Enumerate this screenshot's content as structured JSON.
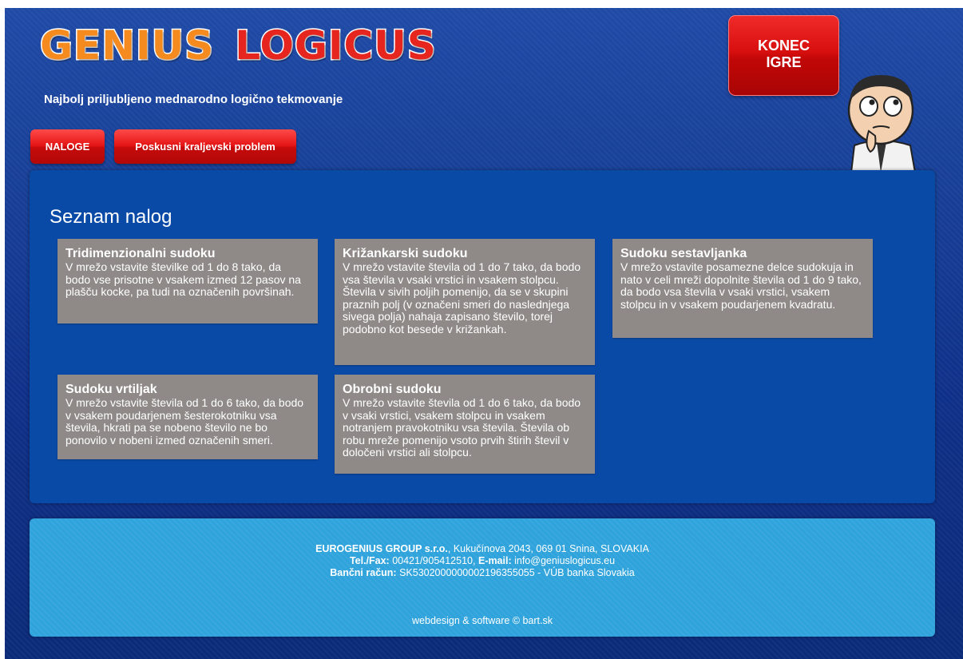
{
  "header": {
    "logo_word_1": "GENIUS",
    "logo_word_2": "LOGICUS",
    "tagline": "Najbolj priljubljeno mednarodno logično tekmovanje",
    "end_game_line1": "KONEC",
    "end_game_line2": "IGRE"
  },
  "nav": {
    "items": [
      {
        "label": "NALOGE"
      },
      {
        "label": "Poskusni kraljevski problem"
      }
    ]
  },
  "main": {
    "title": "Seznam nalog",
    "tasks": [
      {
        "title": "Tridimenzionalni sudoku",
        "description": "V mrežo vstavite številke od 1 do 8 tako, da bodo vse prisotne v vsakem izmed 12 pasov na plašču kocke, pa tudi na označenih površinah."
      },
      {
        "title": "Križankarski sudoku",
        "description": "V mrežo vstavite števila od 1 do 7 tako, da bodo vsa števila v vsaki vrstici in vsakem stolpcu. Števila v sivih poljih pomenijo, da se v skupini praznih polj (v označeni smeri do naslednjega sivega polja) nahaja zapisano število, torej podobno kot besede v križankah."
      },
      {
        "title": "Sudoku sestavljanka",
        "description": "V mrežo vstavite posamezne delce sudokuja in nato v celi mreži dopolnite števila od 1 do 9 tako, da bodo vsa števila v vsaki vrstici, vsakem stolpcu in v vsakem poudarjenem kvadratu."
      },
      {
        "title": "Sudoku vrtiljak",
        "description": "V mrežo vstavite števila od 1 do 6 tako, da bodo v vsakem poudarjenem šesterokotniku vsa števila, hkrati pa se nobeno število ne bo ponovilo v nobeni izmed označenih smeri."
      },
      {
        "title": "Obrobni sudoku",
        "description": "V mrežo vstavite števila od 1 do 6 tako, da bodo v vsaki vrstici, vsakem stolpcu in vsakem notranjem pravokotniku vsa števila. Števila ob robu mreže pomenijo vsoto prvih štirih števil v določeni vrstici ali stolpcu."
      }
    ]
  },
  "footer": {
    "company": "EUROGENIUS GROUP s.r.o.",
    "address": ", Kukučínova 2043, 069 01 Snina, SLOVAKIA",
    "telfax_label": "Tel./Fax:",
    "telfax": " 00421/905412510, ",
    "email_label": "E-mail:",
    "email": " info@geniuslogicus.eu",
    "bank_label": "Bančni račun:",
    "bank": " SK5302000000002196355055 - VÚB banka Slovakia",
    "credit": "webdesign & software © bart.sk"
  },
  "colors": {
    "background": "#173f96",
    "panel": "#0a4aa7",
    "task_box": "#8f8a87",
    "button_red": "#e41414",
    "footer": "#2fa3dc",
    "logo_orange": "#f58a1f",
    "logo_red": "#e6261e"
  }
}
